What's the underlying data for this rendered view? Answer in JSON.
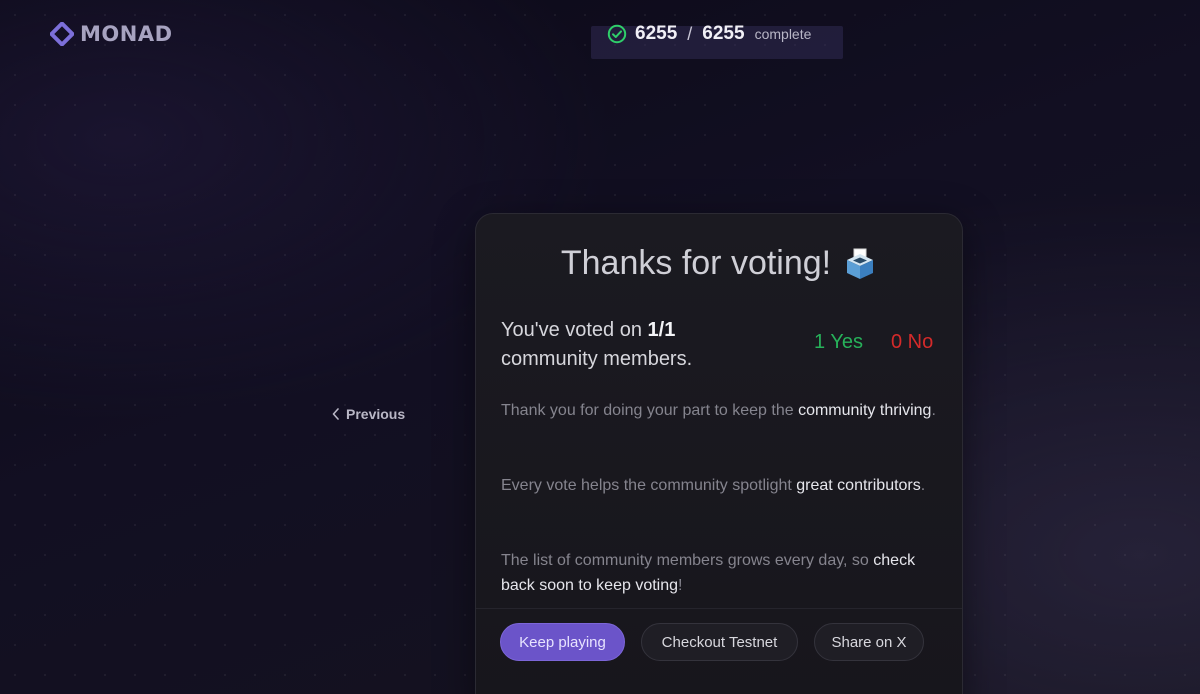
{
  "header": {
    "logo_text": "MONAD",
    "logo_color": "#7c6fd9",
    "progress": {
      "done": "6255",
      "separator": "/",
      "total": "6255",
      "label": "complete",
      "icon": "check-circle-icon",
      "icon_color": "#2fcf6a"
    }
  },
  "nav": {
    "previous_label": "Previous",
    "previous_icon": "chevron-left-icon"
  },
  "card": {
    "title": "Thanks for voting!",
    "title_icon": "ballot-box-icon",
    "voted": {
      "prefix": "You've voted on ",
      "count": "1/1",
      "suffix": "community members."
    },
    "yes_label": "1 Yes",
    "no_label": "0 No",
    "yes_color": "#27b15a",
    "no_color": "#d42a2a",
    "p1": {
      "a": "Thank you for doing your part to keep the ",
      "b": "community thriving",
      "c": "."
    },
    "p2": {
      "a": "Every vote helps the community spotlight ",
      "b": "great contributors",
      "c": "."
    },
    "p3": {
      "a": "The list of community members grows every day, so ",
      "b": "check back soon to keep voting",
      "c": "!"
    },
    "buttons": {
      "keep_playing": "Keep playing",
      "checkout_testnet": "Checkout Testnet",
      "share_x": "Share on X"
    },
    "primary_color": "#6b54c9"
  }
}
